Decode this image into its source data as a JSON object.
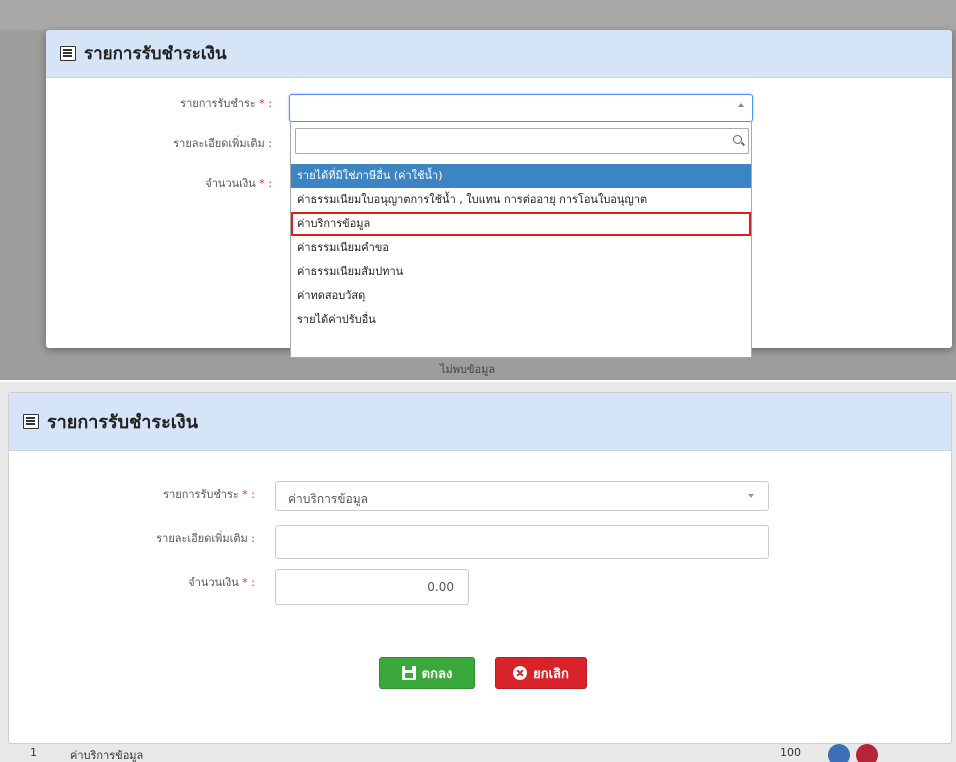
{
  "top": {
    "modal_title": "รายการรับชำระเงิน",
    "fields": {
      "payment_type_label": "รายการรับชำระ",
      "details_label": "รายละเอียดเพิ่มเติม :",
      "amount_label": "จำนวนเงิน",
      "required_mark": "* :"
    },
    "background_text": "ไม่พบข้อมูล",
    "dropdown": {
      "search_placeholder": "",
      "options": [
        "รายได้ที่มิใช่ภาษีอื่น (ค่าใช้น้ำ)",
        "ค่าธรรมเนียมใบอนุญาตการใช้น้ำ , ใบแทน การต่ออายุ การโอนใบอนุญาต",
        "ค่าบริการข้อมูล",
        "ค่าธรรมเนียมคำขอ",
        "ค่าธรรมเนียมสัมปทาน",
        "ค่าทดสอบวัสดุ",
        "รายได้ค่าปรับอื่น"
      ],
      "active_index": 0,
      "highlighted_index": 2
    }
  },
  "bottom": {
    "modal_title": "รายการรับชำระเงิน",
    "fields": {
      "payment_type_label": "รายการรับชำระ",
      "payment_type_value": "ค่าบริการข้อมูล",
      "details_label": "รายละเอียดเพิ่มเติม :",
      "details_value": "",
      "amount_label": "จำนวนเงิน",
      "amount_value": "0.00",
      "required_mark": "* :"
    },
    "buttons": {
      "ok": "ตกลง",
      "cancel": "ยกเลิก"
    },
    "background_row": {
      "index": "1",
      "name": "ค่าบริการข้อมูล",
      "amount": "100"
    }
  },
  "colors": {
    "header_bg": "#d6e4f7",
    "active_option": "#3d84c5",
    "highlight_border": "#e01c1c",
    "ok_button": "#3aa83a",
    "cancel_button": "#d9232b",
    "required": "#e03030"
  },
  "icons": [
    "list-icon",
    "search-icon",
    "save-icon",
    "cancel-icon",
    "edit-icon",
    "delete-icon"
  ]
}
